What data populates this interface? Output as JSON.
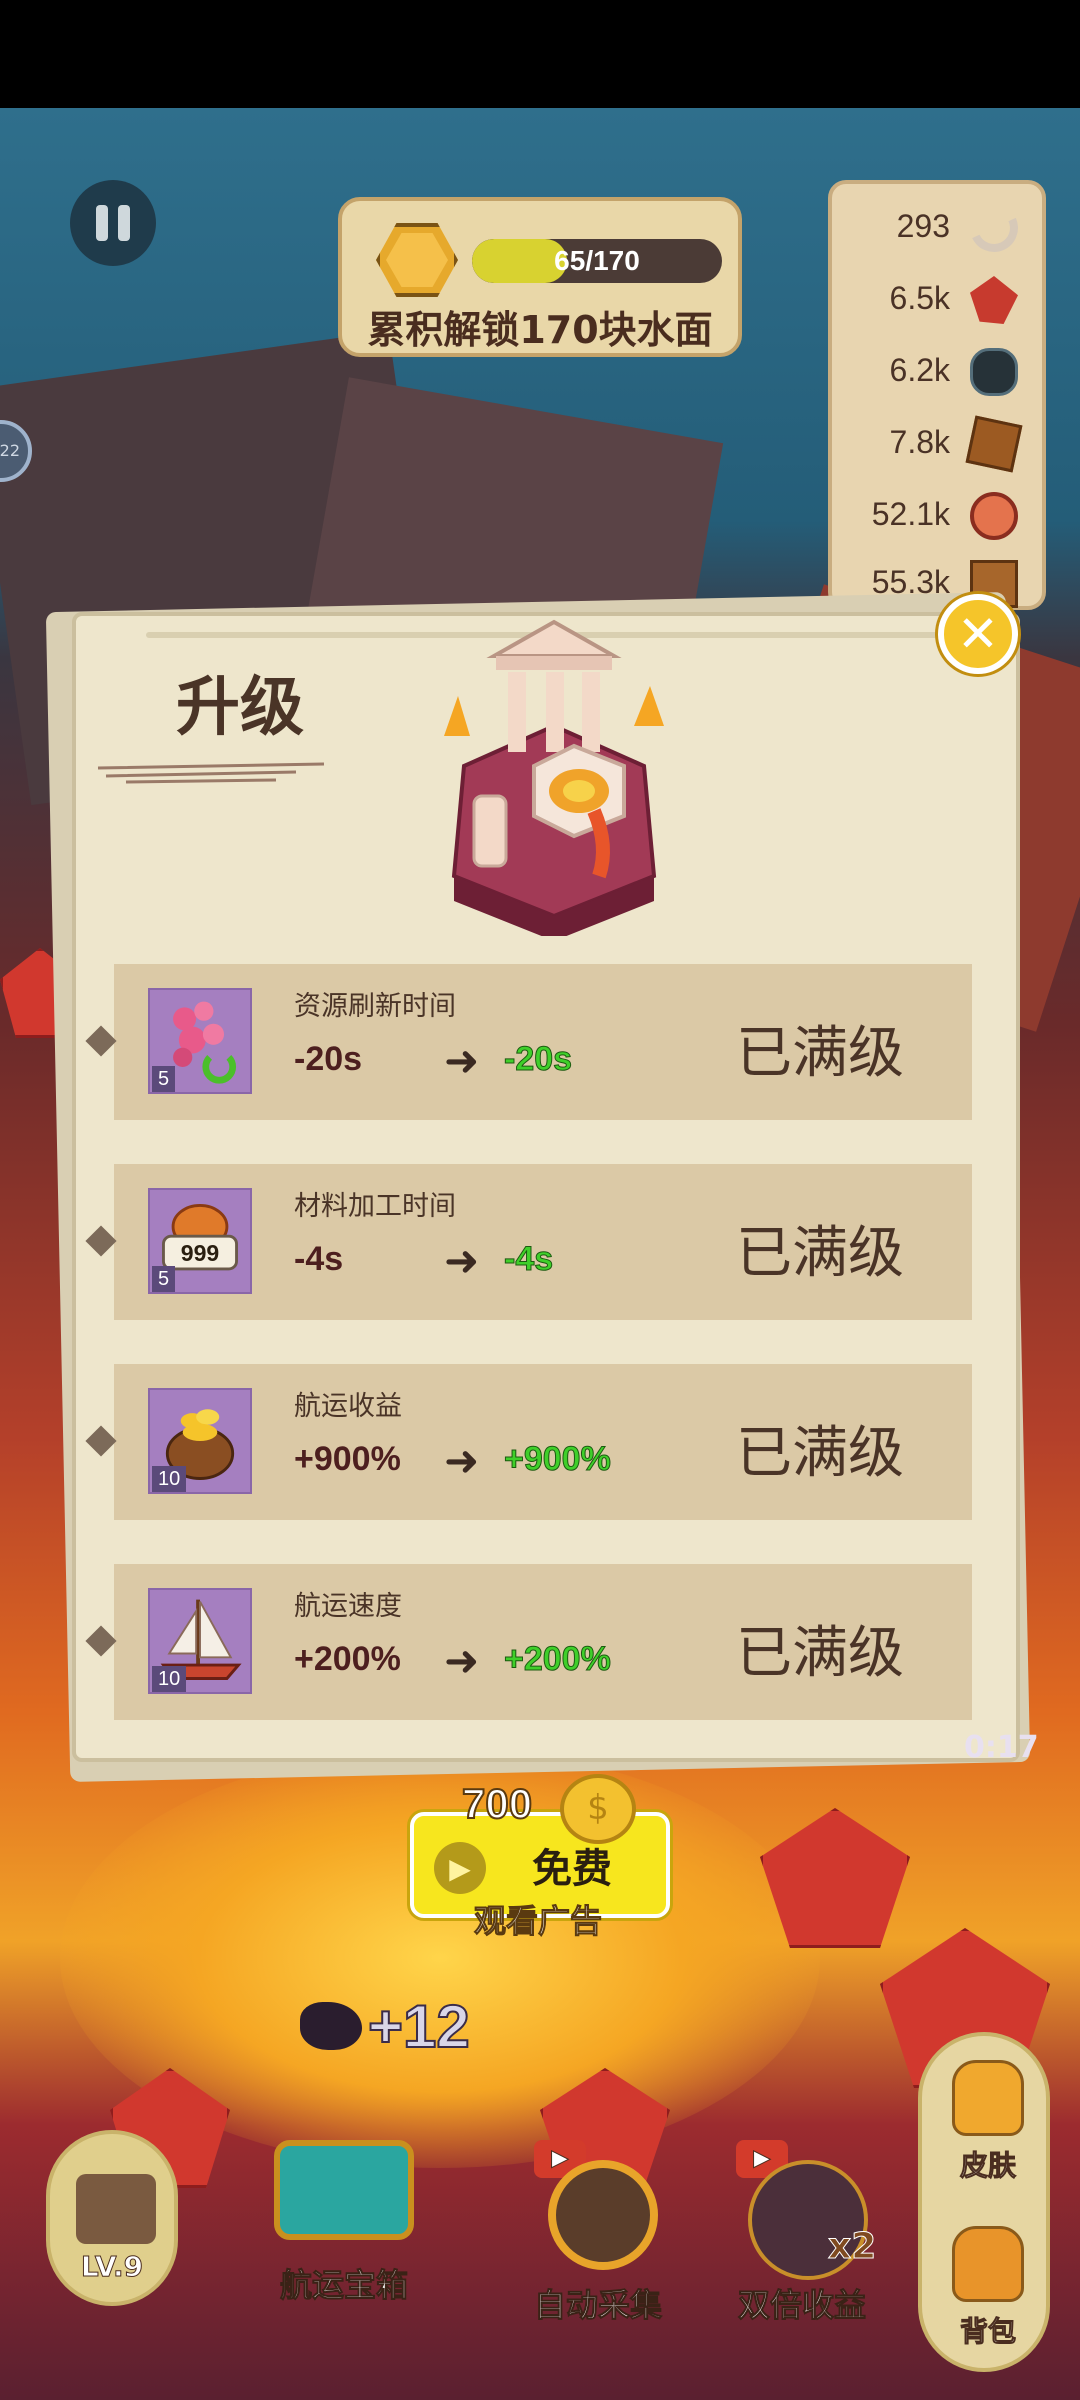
{
  "hud": {
    "unlock": {
      "progress_text": "65/170",
      "progress_fraction": 0.38,
      "goal_text": "累积解锁170块水面"
    },
    "resources": [
      {
        "icon": "horn-icon",
        "value": "293"
      },
      {
        "icon": "red-gem-icon",
        "value": "6.5k"
      },
      {
        "icon": "ore-icon",
        "value": "6.2k"
      },
      {
        "icon": "wood-block-icon",
        "value": "7.8k"
      },
      {
        "icon": "meat-slice-icon",
        "value": "52.1k"
      },
      {
        "icon": "plank-icon",
        "value": "55.3k"
      }
    ],
    "side_badge": "22"
  },
  "modal": {
    "title": "升级",
    "rows": [
      {
        "name": "资源刷新时间",
        "level": "5",
        "current": "-20s",
        "next": "-20s",
        "status": "已满级",
        "icon": "coral-icon"
      },
      {
        "name": "材料加工时间",
        "level": "5",
        "current": "-4s",
        "next": "-4s",
        "status": "已满级",
        "icon": "nut-999-icon",
        "icon_text": "999"
      },
      {
        "name": "航运收益",
        "level": "10",
        "current": "+900%",
        "next": "+900%",
        "status": "已满级",
        "icon": "gold-sack-icon"
      },
      {
        "name": "航运速度",
        "level": "10",
        "current": "+200%",
        "next": "+200%",
        "status": "已满级",
        "icon": "sailboat-icon"
      }
    ]
  },
  "ad": {
    "cost": "700",
    "free_label": "免费",
    "watch_label": "观看广告"
  },
  "gain": {
    "text": "+12"
  },
  "timer": "0:17",
  "bottom": {
    "level": "LV.9",
    "chest": "航运宝箱",
    "auto": "自动采集",
    "double": "双倍收益",
    "double_badge": "x2",
    "skin": "皮肤",
    "bag": "背包"
  },
  "colors": {
    "upgrade_green": "#3fcf2a",
    "button_yellow": "#f7e61e",
    "panel_beige": "#eee6cc"
  }
}
